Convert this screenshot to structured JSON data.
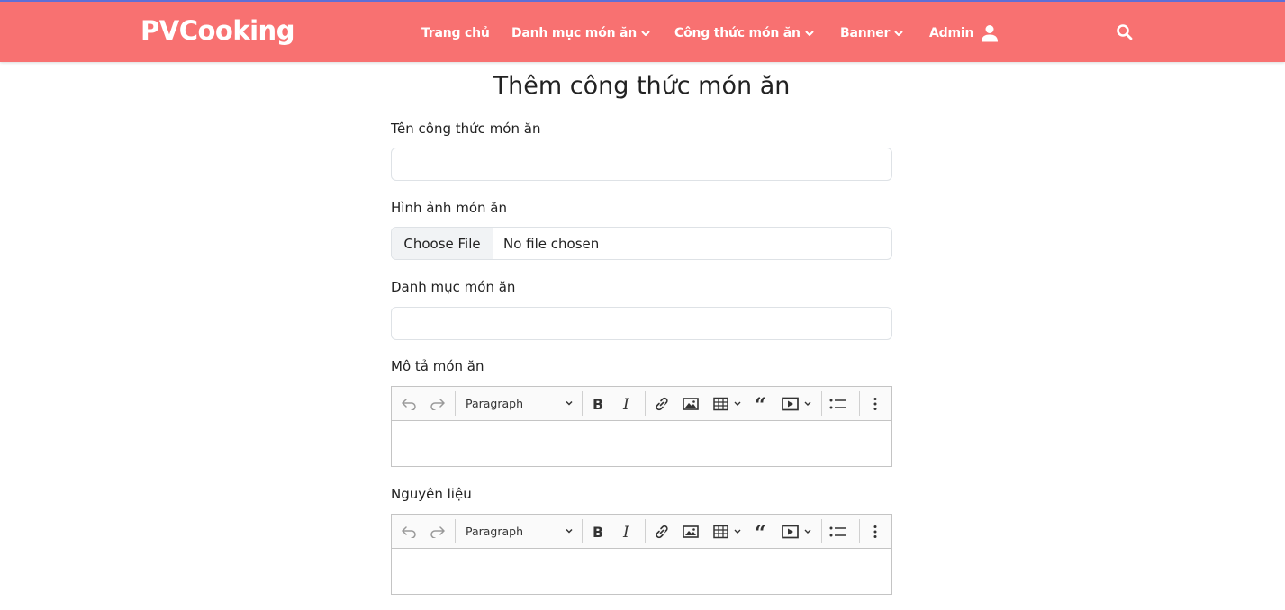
{
  "nav": {
    "brand": "PVCooking",
    "items": [
      {
        "label": "Trang chủ"
      },
      {
        "label": "Danh mục món ăn"
      },
      {
        "label": "Công thức món ăn"
      },
      {
        "label": "Banner"
      },
      {
        "label": "Admin"
      }
    ],
    "icons": {
      "dropdown": "chevron-down-icon",
      "user": "user-icon",
      "search": "search-icon"
    }
  },
  "form": {
    "title": "Thêm công thức món ăn",
    "name_label": "Tên công thức món ăn",
    "name_value": "",
    "image_label": "Hình ảnh món ăn",
    "file_button": "Choose File",
    "file_status": "No file chosen",
    "category_label": "Danh mục món ăn",
    "category_value": "",
    "description_label": "Mô tả món ăn",
    "ingredients_label": "Nguyên liệu"
  },
  "editor": {
    "heading_select": "Paragraph",
    "toolbar_icons": [
      "undo-icon",
      "redo-icon",
      "bold-icon",
      "italic-icon",
      "link-icon",
      "image-icon",
      "table-icon",
      "blockquote-icon",
      "media-icon",
      "bulleted-list-icon",
      "more-icon"
    ]
  },
  "colors": {
    "navbar": "#f87171",
    "navbar_top_border": "#5f6fd6",
    "text": "#222222"
  }
}
